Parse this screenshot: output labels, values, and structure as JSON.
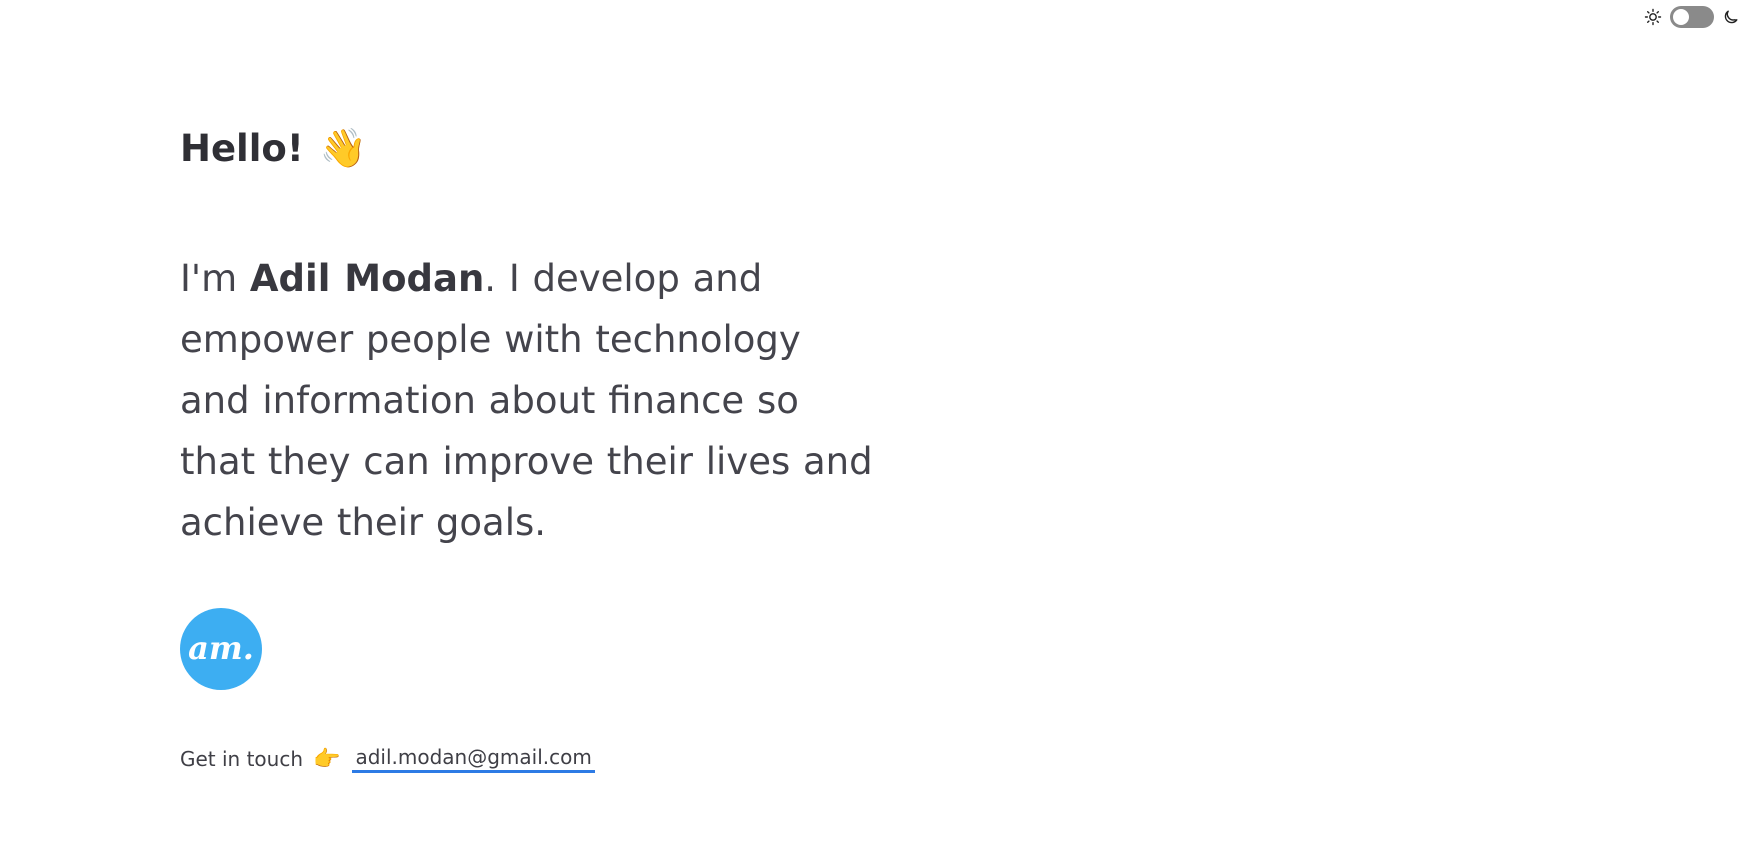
{
  "theme_toggle": {
    "light_icon": "sun-icon",
    "dark_icon": "moon-icon",
    "state": "light"
  },
  "hero": {
    "greeting": "Hello!",
    "greeting_emoji": "👋",
    "intro_prefix": "I'm ",
    "name": "Adil Modan",
    "intro_suffix": ". I develop and empower people with technology and information about finance so that they can improve their lives and achieve their goals."
  },
  "logo": {
    "text": "am.",
    "color": "#3daef2"
  },
  "contact": {
    "label": "Get in touch",
    "emoji": "👉",
    "email": "adil.modan@gmail.com",
    "underline_color": "#2d7be5"
  }
}
